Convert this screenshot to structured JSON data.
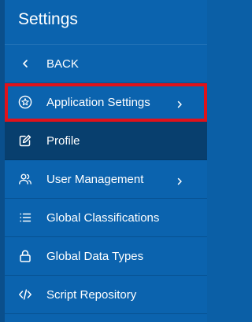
{
  "header": {
    "title": "Settings"
  },
  "menu": {
    "items": [
      {
        "label": "BACK",
        "icon": "chevron-left-icon"
      },
      {
        "label": "Application Settings",
        "icon": "star-badge-icon",
        "has_submenu": true,
        "highlighted": true
      },
      {
        "label": "Profile",
        "icon": "edit-icon",
        "active": true
      },
      {
        "label": "User Management",
        "icon": "users-icon",
        "has_submenu": true
      },
      {
        "label": "Global Classifications",
        "icon": "list-icon"
      },
      {
        "label": "Global Data Types",
        "icon": "lock-icon"
      },
      {
        "label": "Script Repository",
        "icon": "code-icon"
      }
    ]
  },
  "colors": {
    "panel": "#0b63ae",
    "active": "#083f6e",
    "highlight": "#e1121a",
    "text": "#ffffff"
  }
}
